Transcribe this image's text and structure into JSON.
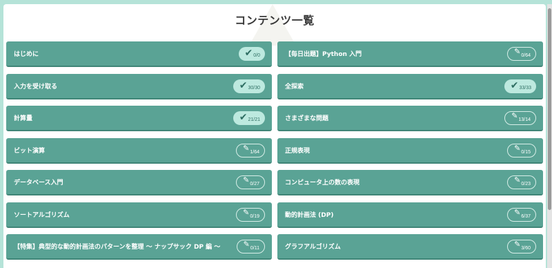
{
  "page_title": "コンテンツ一覧",
  "colors": {
    "card": "#5aa395",
    "done_badge": "#bde9df",
    "background": "#b5e3d8"
  },
  "icons": {
    "completed": "check-icon",
    "in_progress": "pencil-icon"
  },
  "left_column": [
    {
      "label": "はじめに",
      "progress": "0/0",
      "status": "done"
    },
    {
      "label": "入力を受け取る",
      "progress": "30/30",
      "status": "done"
    },
    {
      "label": "計算量",
      "progress": "21/21",
      "status": "done"
    },
    {
      "label": "ビット演算",
      "progress": "1/64",
      "status": "progress"
    },
    {
      "label": "データベース入門",
      "progress": "0/27",
      "status": "progress"
    },
    {
      "label": "ソートアルゴリズム",
      "progress": "0/19",
      "status": "progress"
    },
    {
      "label": "【特集】典型的な動的計画法のパターンを整理 〜 ナップサック DP 編 〜",
      "progress": "0/11",
      "status": "progress"
    }
  ],
  "right_column": [
    {
      "label": "【毎日出題】Python 入門",
      "progress": "0/64",
      "status": "progress"
    },
    {
      "label": "全探索",
      "progress": "33/33",
      "status": "done"
    },
    {
      "label": "さまざまな問題",
      "progress": "13/14",
      "status": "progress"
    },
    {
      "label": "正規表現",
      "progress": "0/15",
      "status": "progress"
    },
    {
      "label": "コンピュータ上の数の表現",
      "progress": "0/23",
      "status": "progress"
    },
    {
      "label": "動的計画法 (DP)",
      "progress": "6/37",
      "status": "progress"
    },
    {
      "label": "グラフアルゴリズム",
      "progress": "3/60",
      "status": "progress"
    }
  ]
}
